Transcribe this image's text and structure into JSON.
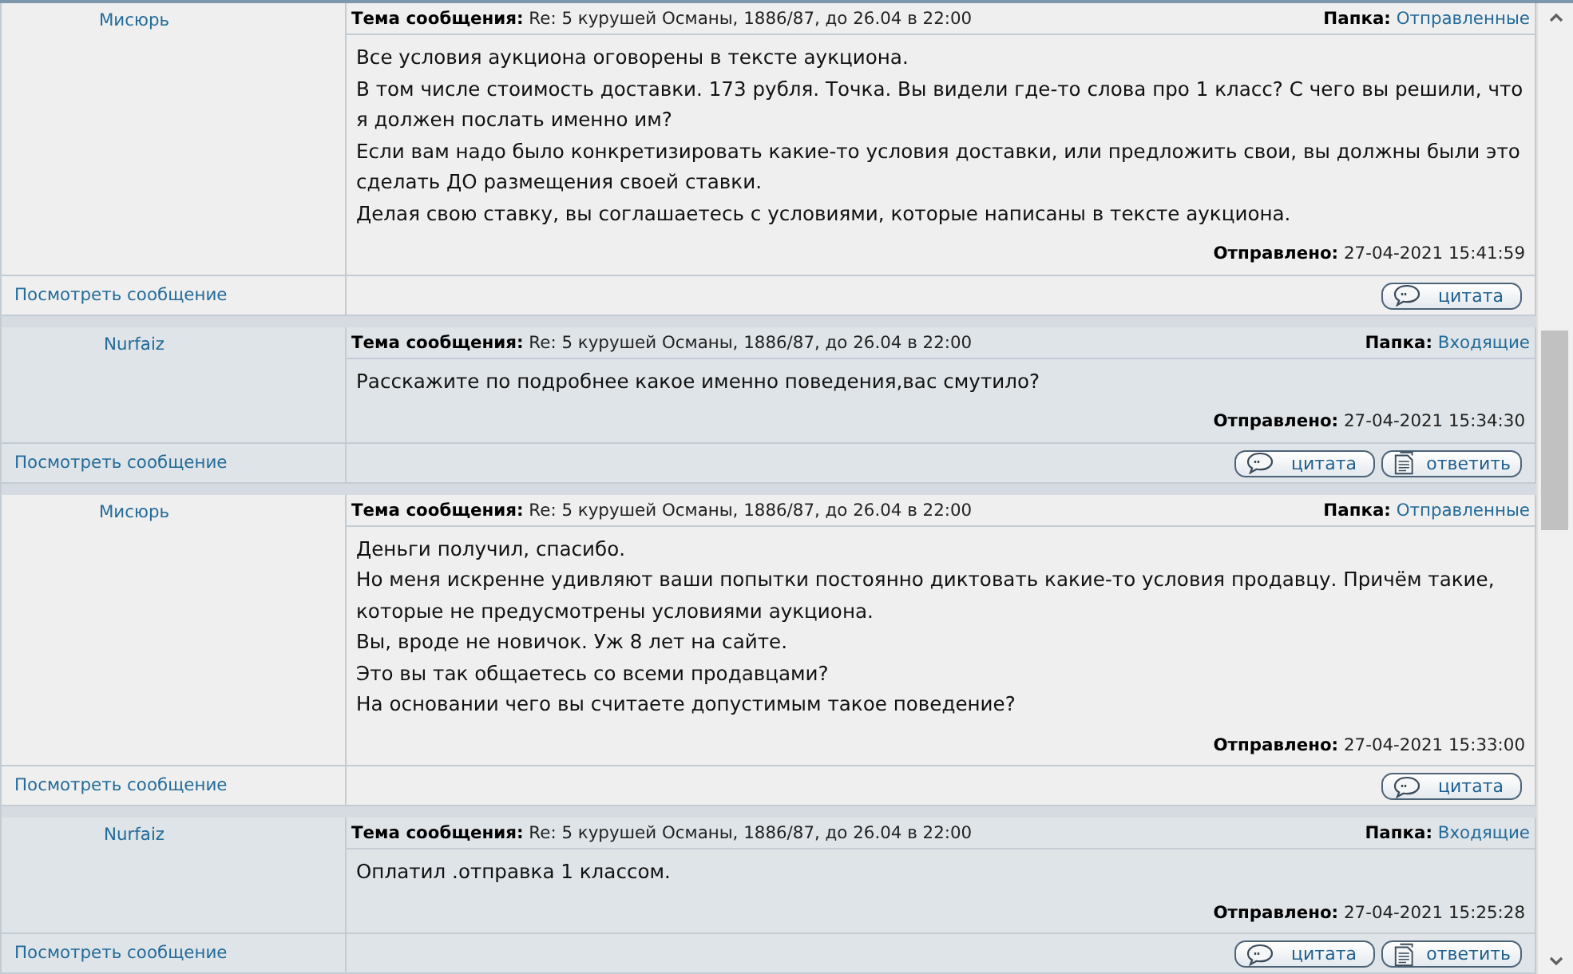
{
  "messages": [
    {
      "author": "Мисюрь",
      "shaded": false,
      "subject_label": "Тема сообщения:",
      "subject": "Re: 5 курушей Османы, 1886/87, до 26.04 в 22:00",
      "folder_label": "Папка:",
      "folder": "Отправленные",
      "paragraphs": [
        "Все условия аукциона оговорены в тексте аукциона.",
        "В том числе стоимость доставки. 173 рубля. Точка. Вы видели где-то слова про 1 класс? С чего вы решили, что я должен послать именно им?",
        "Если вам надо было конкретизировать какие-то условия доставки, или предложить свои, вы должны были это сделать ДО размещения своей ставки.",
        "Делая свою ставку, вы соглашаетесь с условиями, которые написаны в тексте аукциона."
      ],
      "sent_label": "Отправлено:",
      "sent": "27-04-2021 15:41:59",
      "view_link": "Посмотреть сообщение",
      "buttons": [
        {
          "kind": "quote",
          "label": "цитата"
        }
      ]
    },
    {
      "author": "Nurfaiz",
      "shaded": true,
      "subject_label": "Тема сообщения:",
      "subject": "Re: 5 курушей Османы, 1886/87, до 26.04 в 22:00",
      "folder_label": "Папка:",
      "folder": "Входящие",
      "paragraphs": [
        "Расскажите по подробнее какое именно поведения,вас смутило?"
      ],
      "sent_label": "Отправлено:",
      "sent": "27-04-2021 15:34:30",
      "view_link": "Посмотреть сообщение",
      "buttons": [
        {
          "kind": "quote",
          "label": "цитата"
        },
        {
          "kind": "reply",
          "label": "ответить"
        }
      ]
    },
    {
      "author": "Мисюрь",
      "shaded": false,
      "subject_label": "Тема сообщения:",
      "subject": "Re: 5 курушей Османы, 1886/87, до 26.04 в 22:00",
      "folder_label": "Папка:",
      "folder": "Отправленные",
      "paragraphs": [
        "Деньги получил, спасибо.",
        "Но меня искренне удивляют ваши попытки постоянно диктовать какие-то условия продавцу. Причём такие, которые не предусмотрены условиями аукциона.",
        "Вы, вроде не новичок. Уж 8 лет на сайте.",
        "Это вы так общаетесь со всеми продавцами?",
        "На основании чего вы считаете допустимым такое поведение?"
      ],
      "sent_label": "Отправлено:",
      "sent": "27-04-2021 15:33:00",
      "view_link": "Посмотреть сообщение",
      "buttons": [
        {
          "kind": "quote",
          "label": "цитата"
        }
      ]
    },
    {
      "author": "Nurfaiz",
      "shaded": true,
      "subject_label": "Тема сообщения:",
      "subject": "Re: 5 курушей Османы, 1886/87, до 26.04 в 22:00",
      "folder_label": "Папка:",
      "folder": "Входящие",
      "paragraphs": [
        "Оплатил .отправка 1 классом."
      ],
      "sent_label": "Отправлено:",
      "sent": "27-04-2021 15:25:28",
      "view_link": "Посмотреть сообщение",
      "buttons": [
        {
          "kind": "quote",
          "label": "цитата"
        },
        {
          "kind": "reply",
          "label": "ответить"
        }
      ]
    }
  ]
}
